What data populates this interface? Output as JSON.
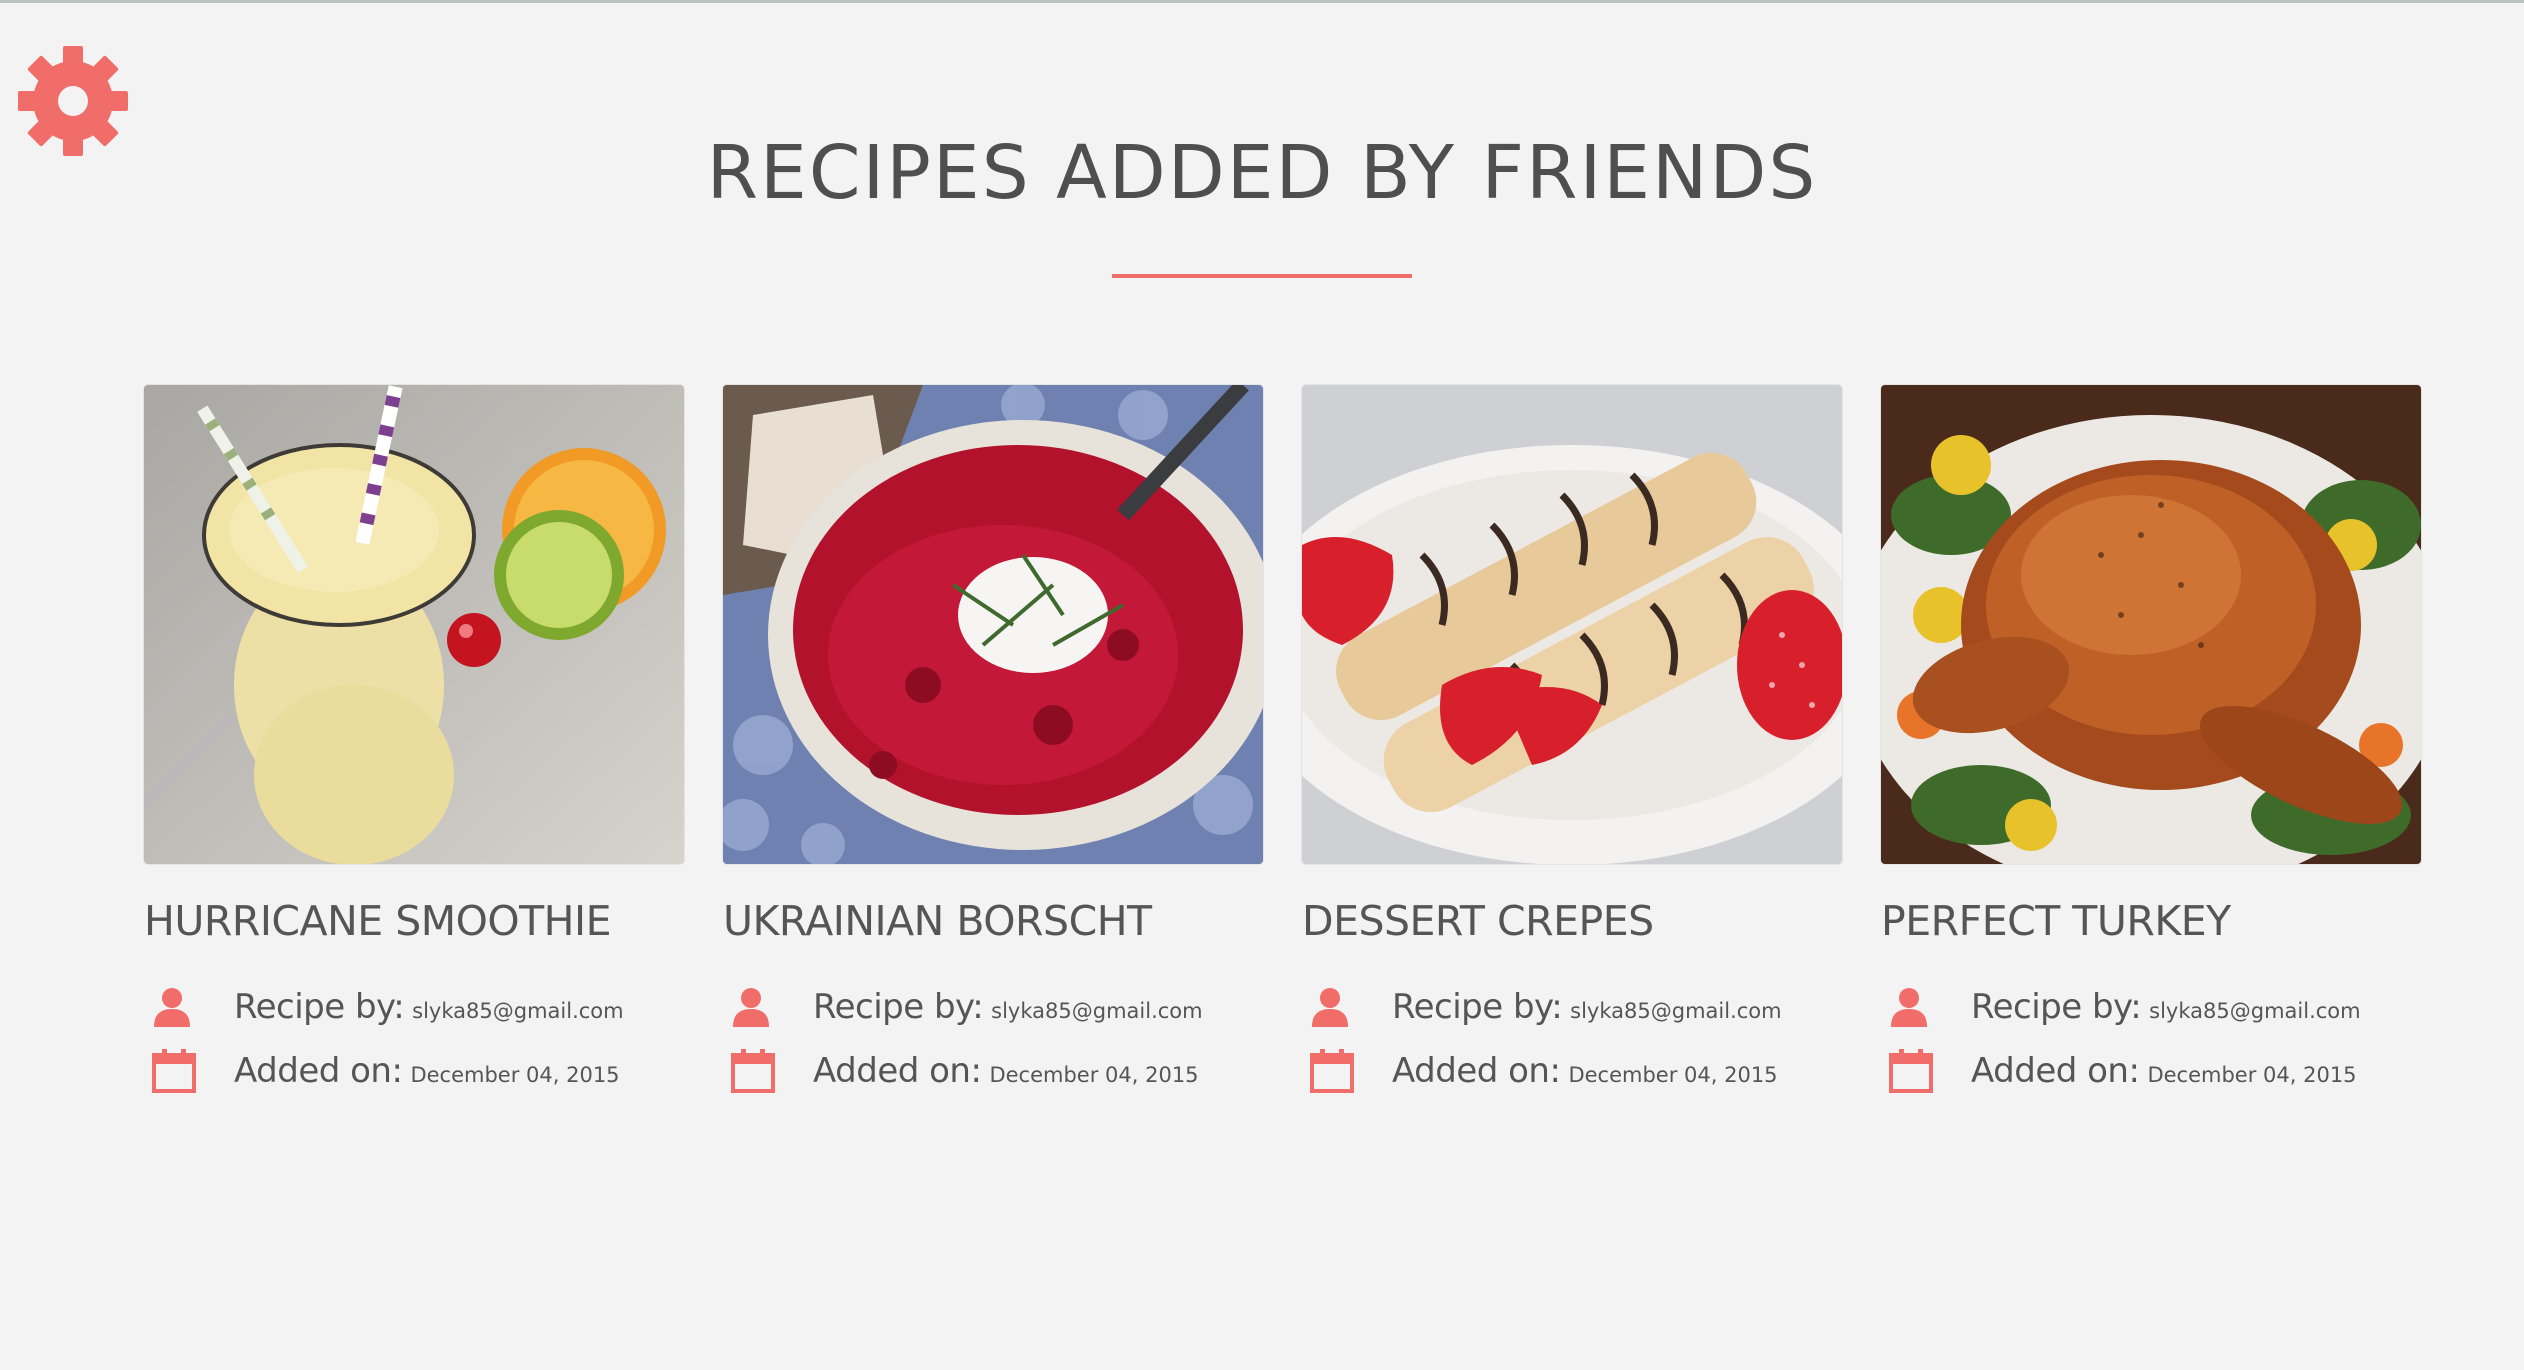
{
  "page": {
    "title": "RECIPES ADDED BY FRIENDS",
    "accent_color": "#f16d69",
    "background_color": "#f3f3f3"
  },
  "settings": {
    "icon": "gear-icon"
  },
  "recipes": [
    {
      "title": "HURRICANE SMOOTHIE",
      "image": "smoothie-photo",
      "recipe_by_label": "Recipe by:",
      "recipe_by": "slyka85@gmail.com",
      "added_on_label": "Added on:",
      "added_on": "December 04, 2015"
    },
    {
      "title": "UKRAINIAN BORSCHT",
      "image": "borscht-photo",
      "recipe_by_label": "Recipe by:",
      "recipe_by": "slyka85@gmail.com",
      "added_on_label": "Added on:",
      "added_on": "December 04, 2015"
    },
    {
      "title": "DESSERT CREPES",
      "image": "crepes-photo",
      "recipe_by_label": "Recipe by:",
      "recipe_by": "slyka85@gmail.com",
      "added_on_label": "Added on:",
      "added_on": "December 04, 2015"
    },
    {
      "title": "PERFECT TURKEY",
      "image": "turkey-photo",
      "recipe_by_label": "Recipe by:",
      "recipe_by": "slyka85@gmail.com",
      "added_on_label": "Added on:",
      "added_on": "December 04, 2015"
    }
  ]
}
